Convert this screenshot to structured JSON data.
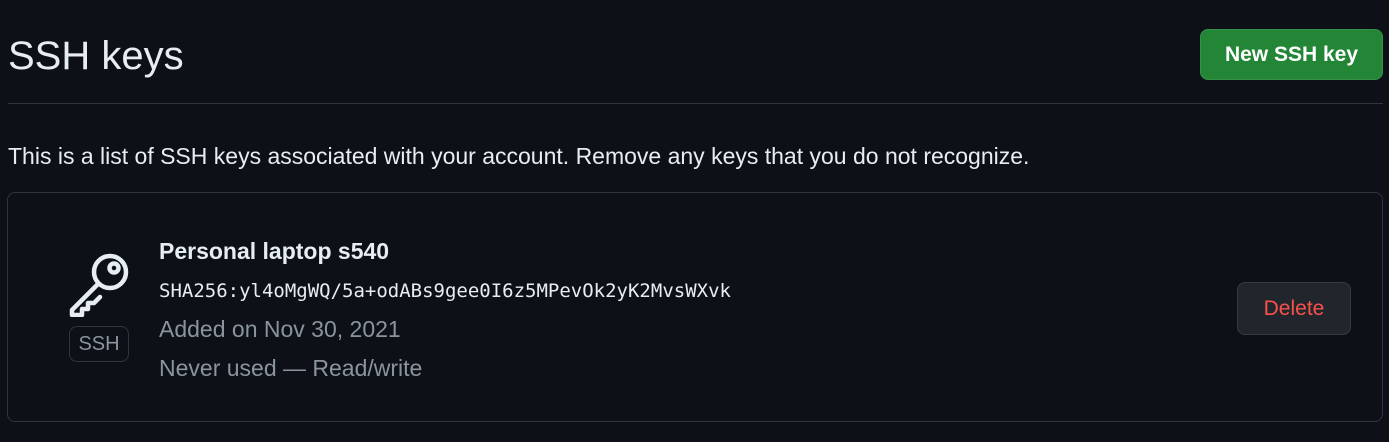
{
  "header": {
    "title": "SSH keys",
    "new_key_label": "New SSH key"
  },
  "intro": {
    "text": "This is a list of SSH keys associated with your account. Remove any keys that you do not recognize."
  },
  "keys": [
    {
      "title": "Personal laptop s540",
      "fingerprint": "SHA256:yl4oMgWQ/5a+odABs9gee0I6z5MPevOk2yK2MvsWXvk",
      "added": "Added on Nov 30, 2021",
      "usage": "Never used — Read/write",
      "badge": "SSH",
      "icon": "key-icon",
      "delete_label": "Delete"
    }
  ],
  "colors": {
    "background": "#0d1117",
    "accent_green": "#238636",
    "danger": "#f85149",
    "muted_text": "#8b949e",
    "border": "#30363d"
  }
}
